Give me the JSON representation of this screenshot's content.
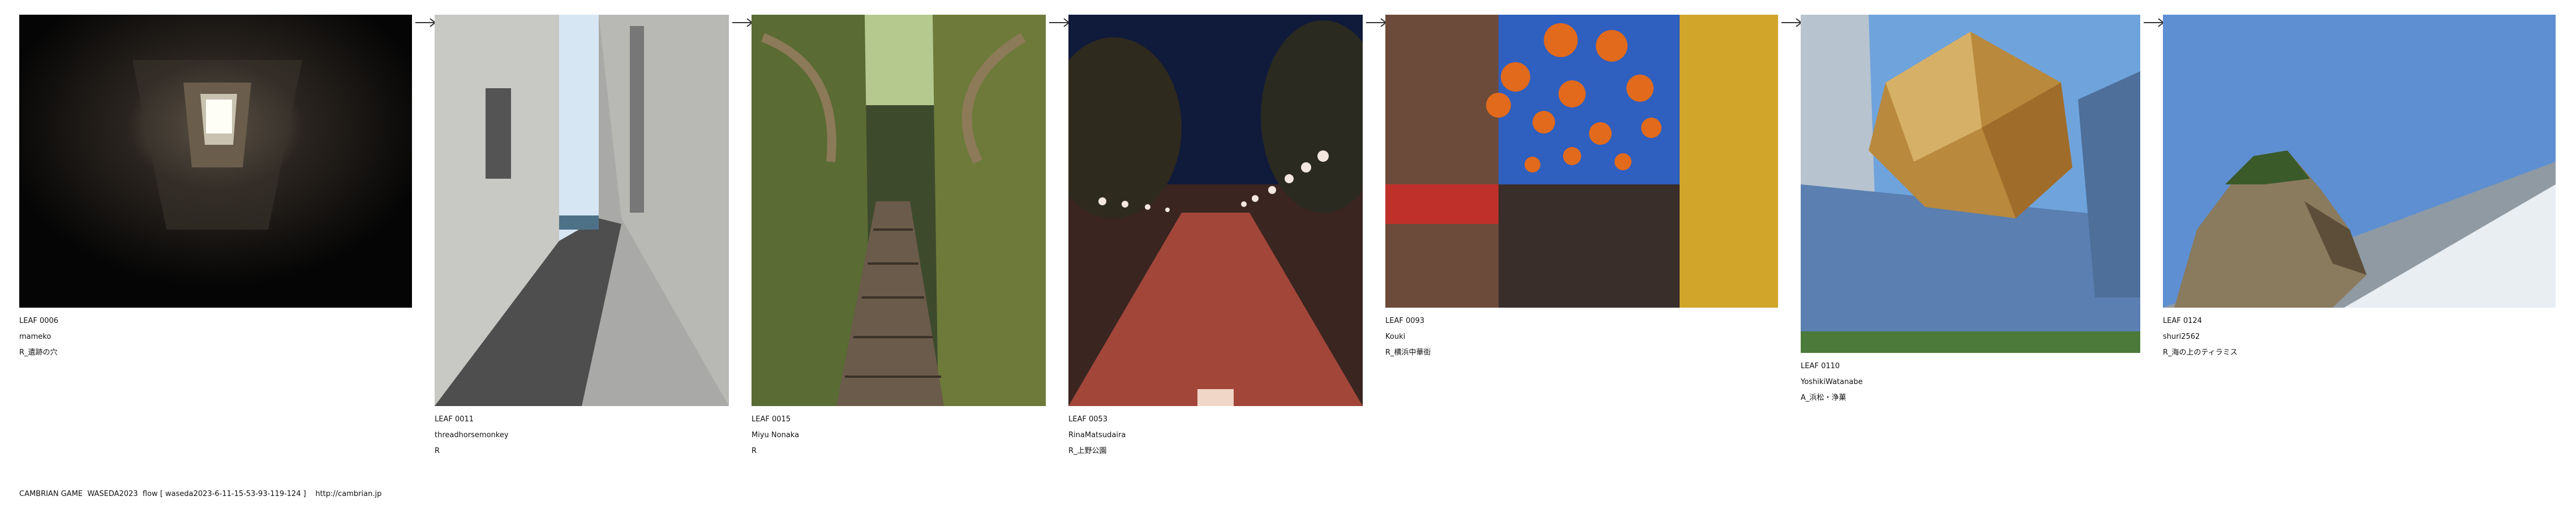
{
  "leaves": [
    {
      "id": "LEAF 0006",
      "user": "mameko",
      "tag": "R_遺跡の穴"
    },
    {
      "id": "LEAF 0011",
      "user": "threadhorsemonkey",
      "tag": "R"
    },
    {
      "id": "LEAF 0015",
      "user": "Miyu Nonaka",
      "tag": "R"
    },
    {
      "id": "LEAF 0053",
      "user": "RinaMatsudaira",
      "tag": "R_上野公園"
    },
    {
      "id": "LEAF 0093",
      "user": "Kouki",
      "tag": "R_横浜中華街"
    },
    {
      "id": "LEAF 0110",
      "user": "YoshikiWatanabe",
      "tag": "A_浜松・浄菓"
    },
    {
      "id": "LEAF 0124",
      "user": "shuri2562",
      "tag": "R_海の上のティラミス"
    }
  ],
  "footer": {
    "text": "CAMBRIAN GAME  WASEDA2023  flow [ waseda2023-6-11-15-53-93-119-124 ]    http://cambrian.jp"
  },
  "icons": {
    "arrow": "right-arrow-icon"
  }
}
